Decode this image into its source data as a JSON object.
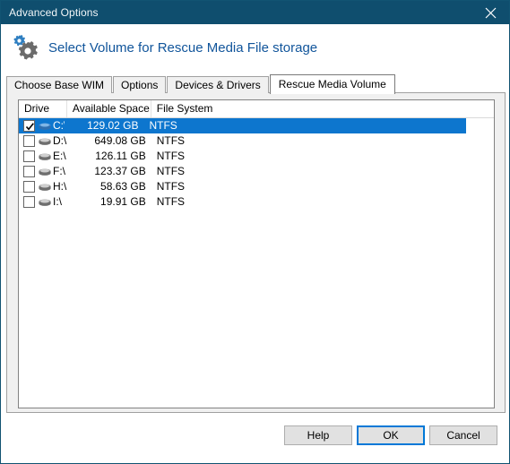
{
  "window": {
    "title": "Advanced Options",
    "close_icon": "close-icon",
    "titlebar_color": "#0f4e6e"
  },
  "header": {
    "icon": "gears-icon",
    "title": "Select Volume for Rescue Media File storage",
    "title_color": "#11559b"
  },
  "tabs": [
    {
      "label": "Choose Base WIM",
      "active": false
    },
    {
      "label": "Options",
      "active": false
    },
    {
      "label": "Devices & Drivers",
      "active": false
    },
    {
      "label": "Rescue Media Volume",
      "active": true
    }
  ],
  "list": {
    "columns": [
      {
        "key": "drive",
        "label": "Drive"
      },
      {
        "key": "space",
        "label": "Available Space"
      },
      {
        "key": "fs",
        "label": "File System"
      }
    ],
    "rows": [
      {
        "checked": true,
        "selected": true,
        "icon": "hard-drive-icon",
        "drive": "C:\\",
        "space": "129.02 GB",
        "fs": "NTFS"
      },
      {
        "checked": false,
        "selected": false,
        "icon": "hard-drive-icon",
        "drive": "D:\\",
        "space": "649.08 GB",
        "fs": "NTFS"
      },
      {
        "checked": false,
        "selected": false,
        "icon": "hard-drive-icon",
        "drive": "E:\\",
        "space": "126.11 GB",
        "fs": "NTFS"
      },
      {
        "checked": false,
        "selected": false,
        "icon": "hard-drive-icon",
        "drive": "F:\\",
        "space": "123.37 GB",
        "fs": "NTFS"
      },
      {
        "checked": false,
        "selected": false,
        "icon": "hard-drive-icon",
        "drive": "H:\\",
        "space": "58.63 GB",
        "fs": "NTFS"
      },
      {
        "checked": false,
        "selected": false,
        "icon": "hard-drive-icon",
        "drive": "I:\\",
        "space": "19.91 GB",
        "fs": "NTFS"
      }
    ],
    "selection_color": "#0d76ce"
  },
  "footer": {
    "help_label": "Help",
    "ok_label": "OK",
    "cancel_label": "Cancel",
    "focus_color": "#0078d7"
  }
}
